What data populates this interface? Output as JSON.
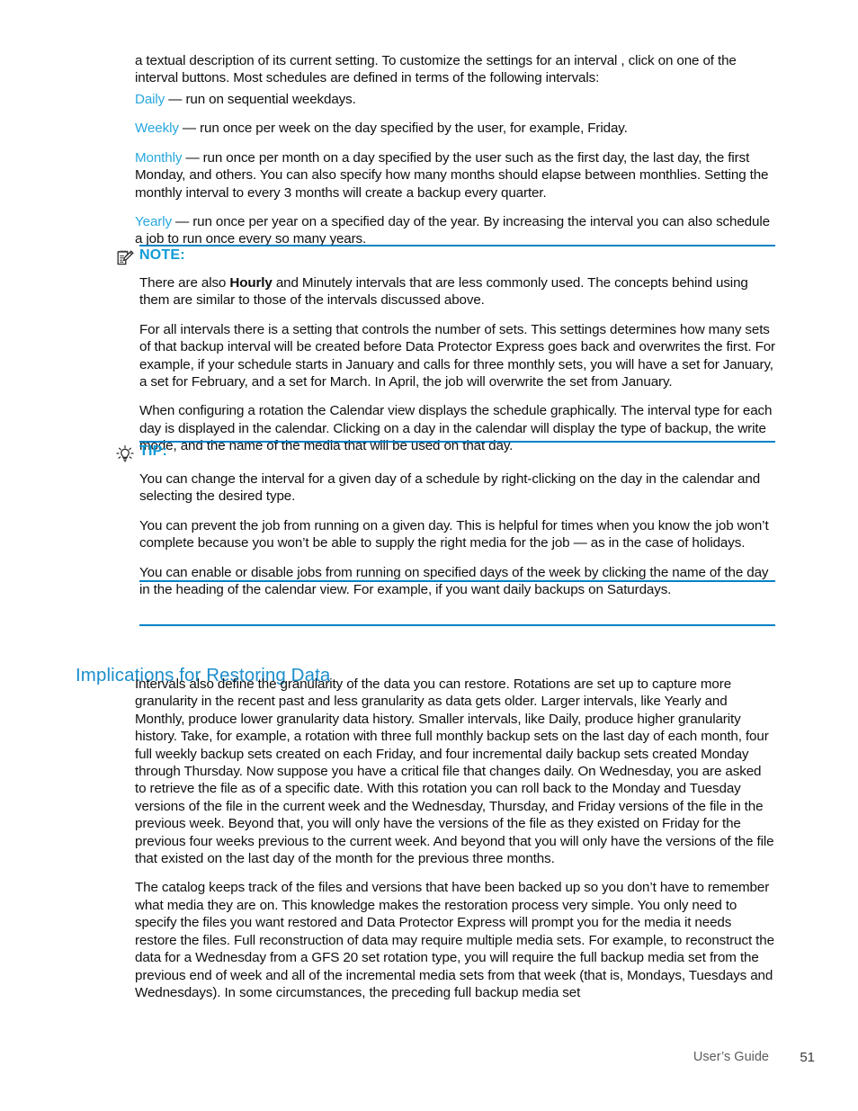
{
  "document": {
    "accent_rule_color": "#0082c8",
    "term_color": "#29a7de",
    "heading_color": "#1b8ecb",
    "admon_label_color": "#0f9bd7"
  },
  "intro": {
    "paragraph": "a textual description of its current setting.  To customize the settings for an interval , click on one of the interval buttons.  Most schedules are defined in terms of the following intervals:"
  },
  "intervals": [
    {
      "term": "Daily",
      "description": " — run on sequential weekdays."
    },
    {
      "term": "Weekly",
      "description": " — run once per week on the day specified by the user, for example, Friday."
    },
    {
      "term": "Monthly",
      "description": " — run once per month on a day specified by the user such as the first day, the last day, the first Monday, and others.  You can also specify how many months should elapse between monthlies.  Setting the monthly interval to every 3 months will create a backup every quarter."
    },
    {
      "term": "Yearly",
      "description": " — run once per year on a specified day of the year.  By increasing the interval you can also schedule a job to run once every so many years."
    }
  ],
  "note": {
    "icon": "notepad-pencil-icon",
    "label": "NOTE:",
    "paragraphs": [
      {
        "pre": "There are also ",
        "bold": "Hourly",
        "post": " and Minutely intervals that are less commonly used.  The concepts behind using them are similar to those of the intervals discussed above."
      },
      {
        "text": "For all intervals there is a setting that controls the number of sets. This settings determines how many sets of that backup interval will be created before Data Protector Express goes back and overwrites the first.  For example, if your schedule starts in January and calls for three monthly sets, you will have a set for January, a set for February, and a set for March.  In April, the job will overwrite the set from January."
      },
      {
        "text": "When configuring a rotation the Calendar view displays the schedule graphically.  The interval type for each day is displayed in the calendar.  Clicking on a day in the calendar will display the type of backup, the write mode, and the name of the media that will be used on that day."
      }
    ]
  },
  "tip": {
    "icon": "lightbulb-icon",
    "label": "TIP:",
    "paragraphs": [
      "You can change the interval for a given day of a schedule by right-clicking on the day in the calendar and selecting the desired type.",
      "You can prevent the job from running on a given day.  This is helpful for times when you know the job won’t complete because you won’t be able to supply the right media for the job — as in the case of holidays.",
      "You can enable or disable jobs from running on specified days of the week by clicking the name of the day in the heading of the calendar view.  For example, if you want daily backups on Saturdays."
    ]
  },
  "section": {
    "heading": "Implications for Restoring Data",
    "paragraphs": [
      "Intervals also define the granularity of the data you can restore.  Rotations are set up to capture more granularity in the recent past and less granularity as data gets older.  Larger intervals, like Yearly and Monthly, produce lower granularity data history. Smaller intervals, like Daily, produce higher granularity history.  Take, for example, a rotation with three full monthly backup sets on the last day of each month, four full weekly backup sets created on each Friday, and four incremental daily backup sets created Monday through Thursday.  Now suppose you have a critical file that changes daily.  On Wednesday, you are asked to retrieve the file as of a specific date.  With this rotation you can roll back to the Monday and Tuesday versions of the file in the current week and the Wednesday, Thursday, and Friday versions of the file in the previous week.  Beyond that, you will only have the versions of the file as they existed on Friday for the previous four weeks previous to the current week.  And beyond that you will only have the versions of the file that existed on the last day of the month for the previous three months.",
      "The catalog keeps track of the files and versions that have been backed up so you don’t have to remember what media they are on.  This knowledge makes the restoration process very simple.  You only need to specify the files you want restored and Data Protector Express will prompt you for the media it needs restore the files.  Full reconstruction of data may require multiple media sets.  For example, to reconstruct the data for a Wednesday from a GFS 20 set rotation type, you will require the full backup media set from the previous end of week and all of the incremental media sets from that week (that is, Mondays, Tuesdays and Wednesdays).  In some circumstances, the preceding full backup media set"
    ]
  },
  "footer": {
    "guide_label": "User’s Guide",
    "page_number": "51"
  }
}
